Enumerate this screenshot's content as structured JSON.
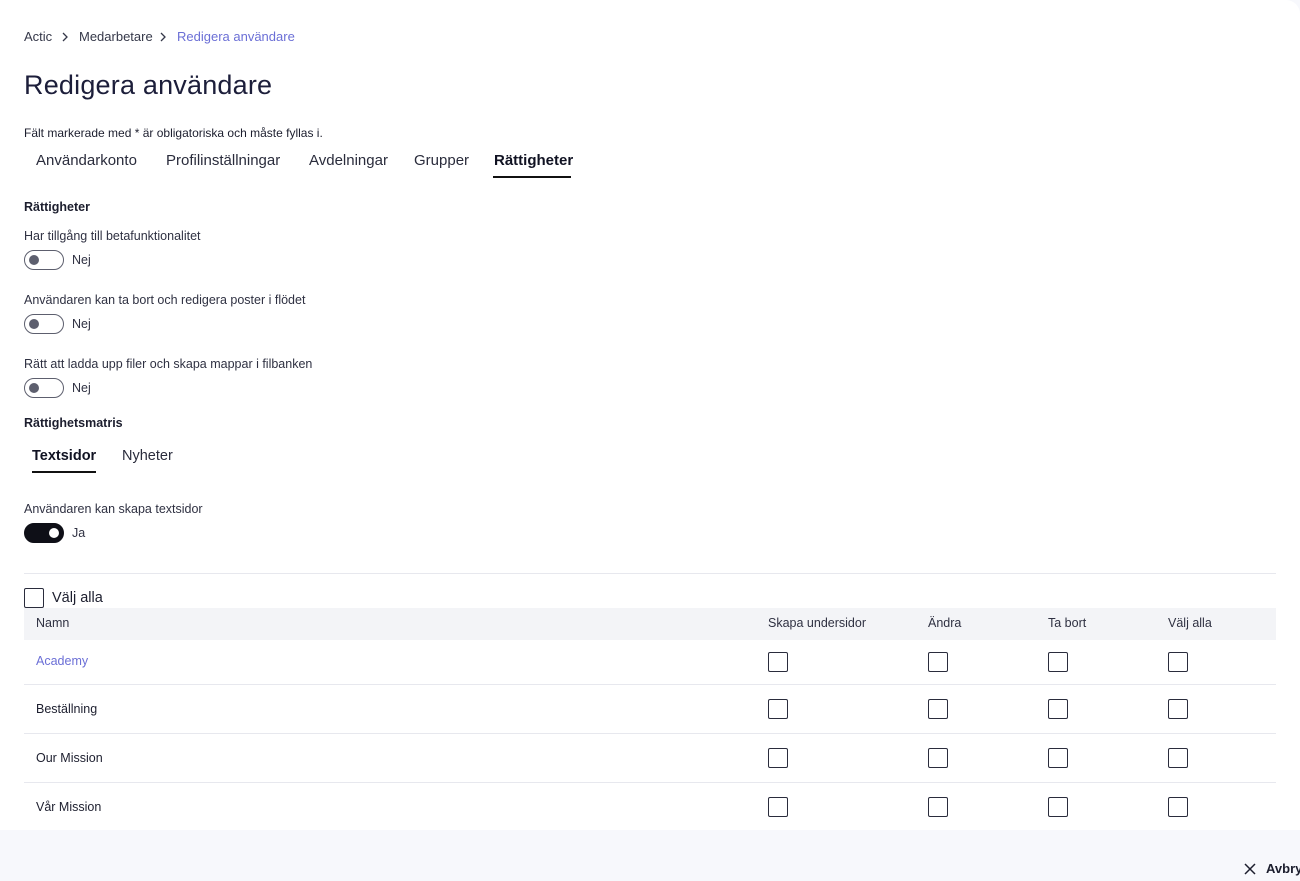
{
  "breadcrumb": [
    "Actic",
    "Medarbetare",
    "Redigera användare"
  ],
  "page": {
    "title": "Redigera användare",
    "required_note": "Fält markerade med * är obligatoriska och måste fyllas i."
  },
  "tabs": [
    {
      "label": "Användarkonto",
      "active": false
    },
    {
      "label": "Profilinställningar",
      "active": false
    },
    {
      "label": "Avdelningar",
      "active": false
    },
    {
      "label": "Grupper",
      "active": false
    },
    {
      "label": "Rättigheter",
      "active": true
    }
  ],
  "permissions": {
    "title": "Rättigheter",
    "toggles": [
      {
        "label": "Har tillgång till betafunktionalitet",
        "state": "Nej",
        "on": false
      },
      {
        "label": "Användaren kan ta bort och redigera poster i flödet",
        "state": "Nej",
        "on": false
      },
      {
        "label": "Rätt att ladda upp filer och skapa mappar i filbanken",
        "state": "Nej",
        "on": false
      }
    ]
  },
  "matrix": {
    "title": "Rättighetsmatris",
    "subtabs": [
      {
        "label": "Textsidor",
        "active": true
      },
      {
        "label": "Nyheter",
        "active": false
      }
    ],
    "create_toggle": {
      "label": "Användaren kan skapa textsidor",
      "state": "Ja",
      "on": true
    },
    "select_all_label": "Välj alla",
    "columns": [
      "Namn",
      "Skapa undersidor",
      "Ändra",
      "Ta bort",
      "Välj alla"
    ],
    "rows": [
      {
        "name": "Academy",
        "link": true,
        "checks": [
          false,
          false,
          false,
          false
        ]
      },
      {
        "name": "Beställning",
        "link": false,
        "checks": [
          false,
          false,
          false,
          false
        ]
      },
      {
        "name": "Our Mission",
        "link": false,
        "checks": [
          false,
          false,
          false,
          false
        ]
      },
      {
        "name": "Vår Mission",
        "link": false,
        "checks": [
          false,
          false,
          false,
          false
        ]
      }
    ]
  },
  "footer": {
    "cancel_label": "Avbryt"
  },
  "colors": {
    "accent": "#6b6fd6",
    "toggle_on": "#0e0f17",
    "background": "#f7f8fc"
  }
}
